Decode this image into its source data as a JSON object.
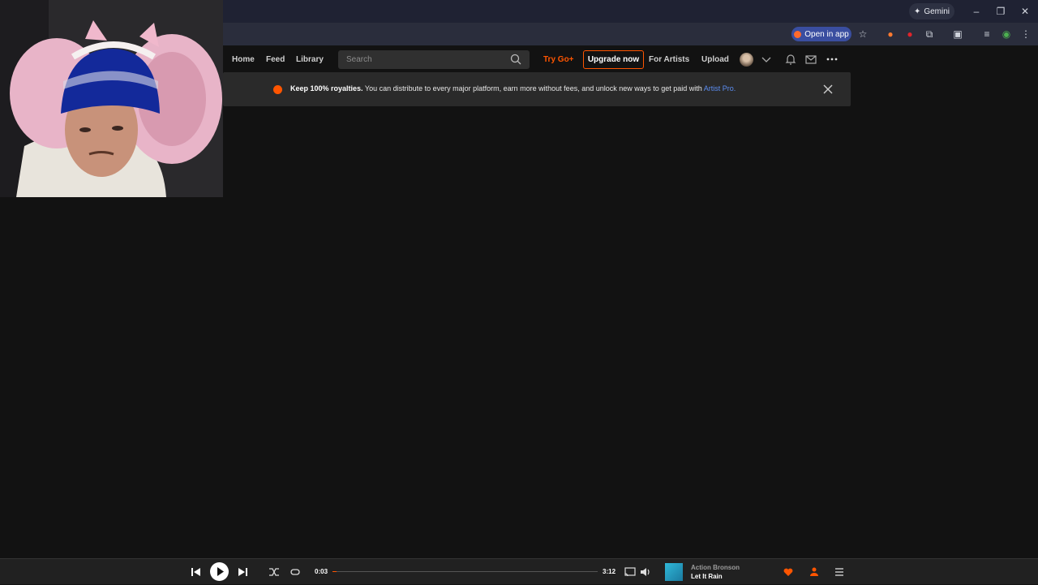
{
  "browser": {
    "gemini_label": "Gemini",
    "open_in_app_label": "Open in app"
  },
  "nav": {
    "home": "Home",
    "feed": "Feed",
    "library": "Library",
    "search_placeholder": "Search",
    "try_go": "Try Go+",
    "upgrade": "Upgrade now",
    "for_artists": "For Artists",
    "upload": "Upload"
  },
  "banner": {
    "bold": "Keep 100% royalties.",
    "text": " You can distribute to every major platform, earn more without fees, and unlock new ways to get paid with ",
    "link": "Artist Pro."
  },
  "player": {
    "current_time": "0:03",
    "duration": "3:12",
    "progress_fraction": 0.016,
    "artist": "Action Bronson",
    "track": "Let It Rain"
  },
  "colors": {
    "accent": "#ff5500",
    "link": "#5c8ef2",
    "background": "#121212"
  }
}
